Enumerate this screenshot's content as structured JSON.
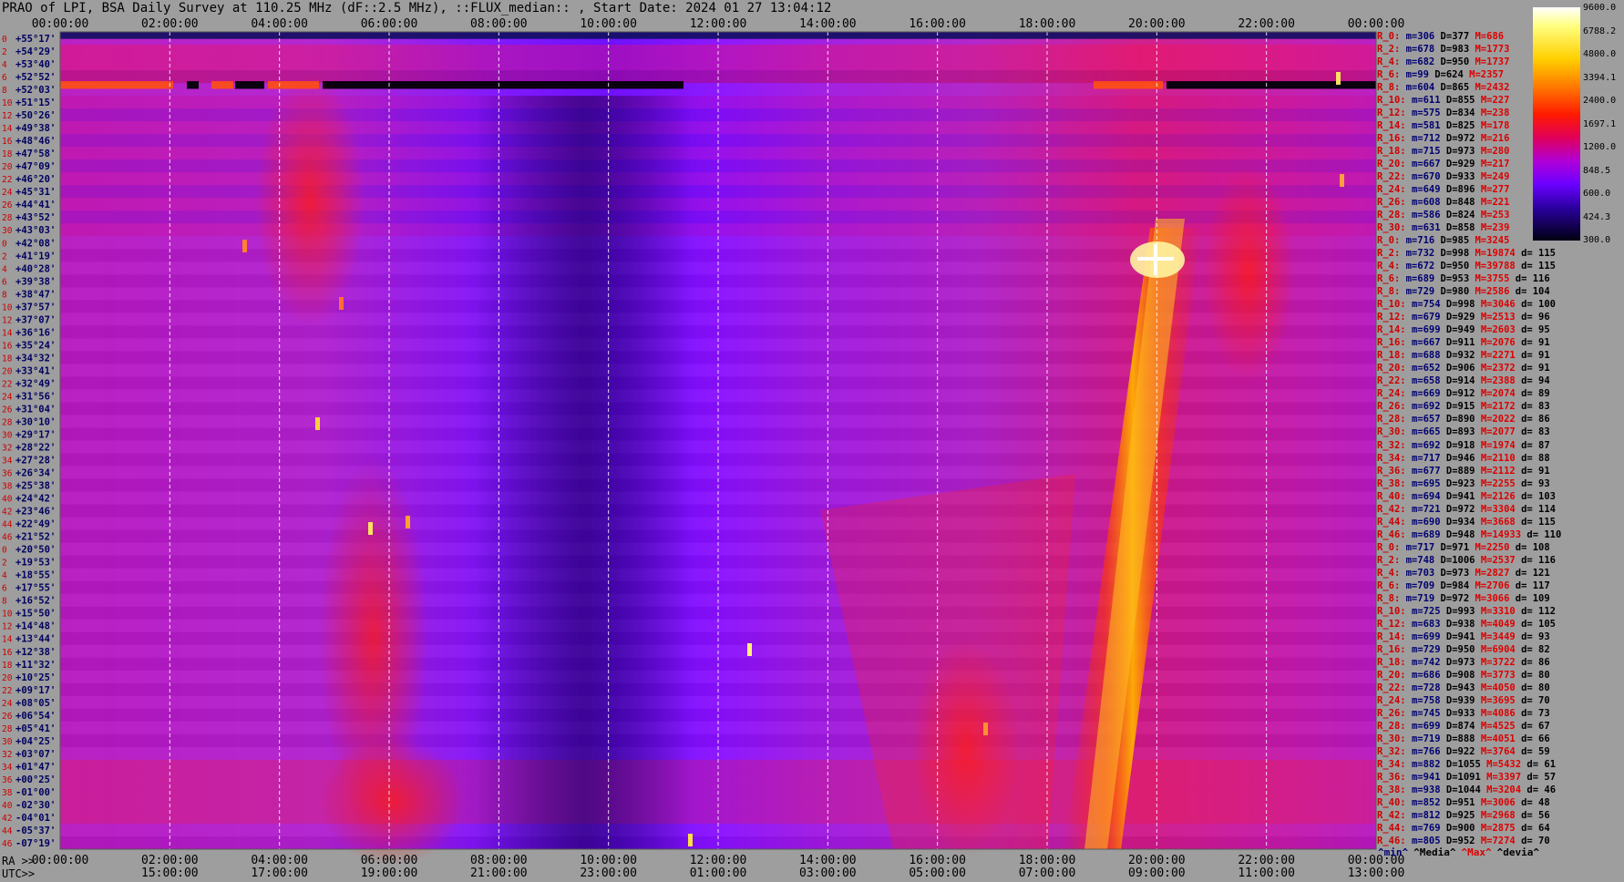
{
  "title": "PRAO of LPI, BSA Daily Survey at 110.25 MHz (dF::2.5 MHz), ::FLUX_median:: , Start Date: 2024 01 27 13:04:12",
  "ra_prefix": "RA >>",
  "utc_prefix": "UTC>>",
  "top_axis": [
    "00:00:00",
    "02:00:00",
    "04:00:00",
    "06:00:00",
    "08:00:00",
    "10:00:00",
    "12:00:00",
    "14:00:00",
    "16:00:00",
    "18:00:00",
    "20:00:00",
    "22:00:00",
    "00:00:00"
  ],
  "bottom_ra_axis": [
    "00:00:00",
    "02:00:00",
    "04:00:00",
    "06:00:00",
    "08:00:00",
    "10:00:00",
    "12:00:00",
    "14:00:00",
    "16:00:00",
    "18:00:00",
    "20:00:00",
    "22:00:00",
    "00:00:00"
  ],
  "bottom_utc_axis": [
    "15:00:00",
    "17:00:00",
    "19:00:00",
    "21:00:00",
    "23:00:00",
    "01:00:00",
    "03:00:00",
    "05:00:00",
    "07:00:00",
    "09:00:00",
    "11:00:00",
    "13:00:00"
  ],
  "row_indices": [
    "0",
    "2",
    "4",
    "6",
    "8",
    "10",
    "12",
    "14",
    "16",
    "18",
    "20",
    "22",
    "24",
    "26",
    "28",
    "30",
    "0",
    "2",
    "4",
    "6",
    "8",
    "10",
    "12",
    "14",
    "16",
    "18",
    "20",
    "22",
    "24",
    "26",
    "28",
    "30",
    "32",
    "34",
    "36",
    "38",
    "40",
    "42",
    "44",
    "46",
    "0",
    "2",
    "4",
    "6",
    "8",
    "10",
    "12",
    "14",
    "16",
    "18",
    "20",
    "22",
    "24",
    "26",
    "28",
    "30",
    "32",
    "34",
    "36",
    "38",
    "40",
    "42",
    "44",
    "46"
  ],
  "declinations": [
    "+55°17'",
    "+54°29'",
    "+53°40'",
    "+52°52'",
    "+52°03'",
    "+51°15'",
    "+50°26'",
    "+49°38'",
    "+48°46'",
    "+47°58'",
    "+47°09'",
    "+46°20'",
    "+45°31'",
    "+44°41'",
    "+43°52'",
    "+43°03'",
    "+42°08'",
    "+41°19'",
    "+40°28'",
    "+39°38'",
    "+38°47'",
    "+37°57'",
    "+37°07'",
    "+36°16'",
    "+35°24'",
    "+34°32'",
    "+33°41'",
    "+32°49'",
    "+31°56'",
    "+31°04'",
    "+30°10'",
    "+29°17'",
    "+28°22'",
    "+27°28'",
    "+26°34'",
    "+25°38'",
    "+24°42'",
    "+23°46'",
    "+22°49'",
    "+21°52'",
    "+20°50'",
    "+19°53'",
    "+18°55'",
    "+17°55'",
    "+16°52'",
    "+15°50'",
    "+14°48'",
    "+13°44'",
    "+12°38'",
    "+11°32'",
    "+10°25'",
    "+09°17'",
    "+08°05'",
    "+06°54'",
    "+05°41'",
    "+04°25'",
    "+03°07'",
    "+01°47'",
    "+00°25'",
    "-01°00'",
    "-02°30'",
    "-04°01'",
    "-05°37'",
    "-07°19'"
  ],
  "stats": [
    {
      "label": "R_0:",
      "min": "m=306",
      "median": "D=377",
      "max": "M=686",
      "devia": ""
    },
    {
      "label": "R_2:",
      "min": "m=678",
      "median": "D=983",
      "max": "M=1773",
      "devia": ""
    },
    {
      "label": "R_4:",
      "min": "m=682",
      "median": "D=950",
      "max": "M=1737",
      "devia": ""
    },
    {
      "label": "R_6:",
      "min": "m=99",
      "median": "D=624",
      "max": "M=2357",
      "devia": ""
    },
    {
      "label": "R_8:",
      "min": "m=604",
      "median": "D=865",
      "max": "M=2432",
      "devia": ""
    },
    {
      "label": "R_10:",
      "min": "m=611",
      "median": "D=855",
      "max": "M=227",
      "devia": ""
    },
    {
      "label": "R_12:",
      "min": "m=575",
      "median": "D=834",
      "max": "M=238",
      "devia": ""
    },
    {
      "label": "R_14:",
      "min": "m=581",
      "median": "D=825",
      "max": "M=178",
      "devia": ""
    },
    {
      "label": "R_16:",
      "min": "m=712",
      "median": "D=972",
      "max": "M=216",
      "devia": ""
    },
    {
      "label": "R_18:",
      "min": "m=715",
      "median": "D=973",
      "max": "M=280",
      "devia": ""
    },
    {
      "label": "R_20:",
      "min": "m=667",
      "median": "D=929",
      "max": "M=217",
      "devia": ""
    },
    {
      "label": "R_22:",
      "min": "m=670",
      "median": "D=933",
      "max": "M=249",
      "devia": ""
    },
    {
      "label": "R_24:",
      "min": "m=649",
      "median": "D=896",
      "max": "M=277",
      "devia": ""
    },
    {
      "label": "R_26:",
      "min": "m=608",
      "median": "D=848",
      "max": "M=221",
      "devia": ""
    },
    {
      "label": "R_28:",
      "min": "m=586",
      "median": "D=824",
      "max": "M=253",
      "devia": ""
    },
    {
      "label": "R_30:",
      "min": "m=631",
      "median": "D=858",
      "max": "M=239",
      "devia": ""
    },
    {
      "label": "R_0:",
      "min": "m=716",
      "median": "D=985",
      "max": "M=3245",
      "devia": ""
    },
    {
      "label": "R_2:",
      "min": "m=732",
      "median": "D=998",
      "max": "M=19874",
      "devia": "d= 115"
    },
    {
      "label": "R_4:",
      "min": "m=672",
      "median": "D=950",
      "max": "M=39788",
      "devia": "d= 115"
    },
    {
      "label": "R_6:",
      "min": "m=689",
      "median": "D=953",
      "max": "M=3755",
      "devia": "d= 116"
    },
    {
      "label": "R_8:",
      "min": "m=729",
      "median": "D=980",
      "max": "M=2586",
      "devia": "d= 104"
    },
    {
      "label": "R_10:",
      "min": "m=754",
      "median": "D=998",
      "max": "M=3046",
      "devia": "d= 100"
    },
    {
      "label": "R_12:",
      "min": "m=679",
      "median": "D=929",
      "max": "M=2513",
      "devia": "d= 96"
    },
    {
      "label": "R_14:",
      "min": "m=699",
      "median": "D=949",
      "max": "M=2603",
      "devia": "d= 95"
    },
    {
      "label": "R_16:",
      "min": "m=667",
      "median": "D=911",
      "max": "M=2076",
      "devia": "d= 91"
    },
    {
      "label": "R_18:",
      "min": "m=688",
      "median": "D=932",
      "max": "M=2271",
      "devia": "d= 91"
    },
    {
      "label": "R_20:",
      "min": "m=652",
      "median": "D=906",
      "max": "M=2372",
      "devia": "d= 91"
    },
    {
      "label": "R_22:",
      "min": "m=658",
      "median": "D=914",
      "max": "M=2388",
      "devia": "d= 94"
    },
    {
      "label": "R_24:",
      "min": "m=669",
      "median": "D=912",
      "max": "M=2074",
      "devia": "d= 89"
    },
    {
      "label": "R_26:",
      "min": "m=692",
      "median": "D=915",
      "max": "M=2172",
      "devia": "d= 83"
    },
    {
      "label": "R_28:",
      "min": "m=657",
      "median": "D=890",
      "max": "M=2022",
      "devia": "d= 86"
    },
    {
      "label": "R_30:",
      "min": "m=665",
      "median": "D=893",
      "max": "M=2077",
      "devia": "d= 83"
    },
    {
      "label": "R_32:",
      "min": "m=692",
      "median": "D=918",
      "max": "M=1974",
      "devia": "d= 87"
    },
    {
      "label": "R_34:",
      "min": "m=717",
      "median": "D=946",
      "max": "M=2110",
      "devia": "d= 88"
    },
    {
      "label": "R_36:",
      "min": "m=677",
      "median": "D=889",
      "max": "M=2112",
      "devia": "d= 91"
    },
    {
      "label": "R_38:",
      "min": "m=695",
      "median": "D=923",
      "max": "M=2255",
      "devia": "d= 93"
    },
    {
      "label": "R_40:",
      "min": "m=694",
      "median": "D=941",
      "max": "M=2126",
      "devia": "d= 103"
    },
    {
      "label": "R_42:",
      "min": "m=721",
      "median": "D=972",
      "max": "M=3304",
      "devia": "d= 114"
    },
    {
      "label": "R_44:",
      "min": "m=690",
      "median": "D=934",
      "max": "M=3668",
      "devia": "d= 115"
    },
    {
      "label": "R_46:",
      "min": "m=689",
      "median": "D=948",
      "max": "M=14933",
      "devia": "d= 110"
    },
    {
      "label": "R_0:",
      "min": "m=717",
      "median": "D=971",
      "max": "M=2250",
      "devia": "d= 108"
    },
    {
      "label": "R_2:",
      "min": "m=748",
      "median": "D=1006",
      "max": "M=2537",
      "devia": "d= 116"
    },
    {
      "label": "R_4:",
      "min": "m=703",
      "median": "D=973",
      "max": "M=2827",
      "devia": "d= 121"
    },
    {
      "label": "R_6:",
      "min": "m=709",
      "median": "D=984",
      "max": "M=2706",
      "devia": "d= 117"
    },
    {
      "label": "R_8:",
      "min": "m=719",
      "median": "D=972",
      "max": "M=3066",
      "devia": "d= 109"
    },
    {
      "label": "R_10:",
      "min": "m=725",
      "median": "D=993",
      "max": "M=3310",
      "devia": "d= 112"
    },
    {
      "label": "R_12:",
      "min": "m=683",
      "median": "D=938",
      "max": "M=4049",
      "devia": "d= 105"
    },
    {
      "label": "R_14:",
      "min": "m=699",
      "median": "D=941",
      "max": "M=3449",
      "devia": "d= 93"
    },
    {
      "label": "R_16:",
      "min": "m=729",
      "median": "D=950",
      "max": "M=6904",
      "devia": "d= 82"
    },
    {
      "label": "R_18:",
      "min": "m=742",
      "median": "D=973",
      "max": "M=3722",
      "devia": "d= 86"
    },
    {
      "label": "R_20:",
      "min": "m=686",
      "median": "D=908",
      "max": "M=3773",
      "devia": "d= 80"
    },
    {
      "label": "R_22:",
      "min": "m=728",
      "median": "D=943",
      "max": "M=4050",
      "devia": "d= 80"
    },
    {
      "label": "R_24:",
      "min": "m=758",
      "median": "D=939",
      "max": "M=3695",
      "devia": "d= 70"
    },
    {
      "label": "R_26:",
      "min": "m=745",
      "median": "D=933",
      "max": "M=4086",
      "devia": "d= 73"
    },
    {
      "label": "R_28:",
      "min": "m=699",
      "median": "D=874",
      "max": "M=4525",
      "devia": "d= 67"
    },
    {
      "label": "R_30:",
      "min": "m=719",
      "median": "D=888",
      "max": "M=4051",
      "devia": "d= 66"
    },
    {
      "label": "R_32:",
      "min": "m=766",
      "median": "D=922",
      "max": "M=3764",
      "devia": "d= 59"
    },
    {
      "label": "R_34:",
      "min": "m=882",
      "median": "D=1055",
      "max": "M=5432",
      "devia": "d= 61"
    },
    {
      "label": "R_36:",
      "min": "m=941",
      "median": "D=1091",
      "max": "M=3397",
      "devia": "d= 57"
    },
    {
      "label": "R_38:",
      "min": "m=938",
      "median": "D=1044",
      "max": "M=3204",
      "devia": "d= 46"
    },
    {
      "label": "R_40:",
      "min": "m=852",
      "median": "D=951",
      "max": "M=3006",
      "devia": "d= 48"
    },
    {
      "label": "R_42:",
      "min": "m=812",
      "median": "D=925",
      "max": "M=2968",
      "devia": "d= 56"
    },
    {
      "label": "R_44:",
      "min": "m=769",
      "median": "D=900",
      "max": "M=2875",
      "devia": "d= 64"
    },
    {
      "label": "R_46:",
      "min": "m=805",
      "median": "D=952",
      "max": "M=7274",
      "devia": "d= 70"
    }
  ],
  "legend_keys": [
    {
      "text": "^min^",
      "color": "#000070"
    },
    {
      "text": "^Media^",
      "color": "#000000"
    },
    {
      "text": "^Max^",
      "color": "#dd0000"
    },
    {
      "text": "^devia^",
      "color": "#000000"
    }
  ],
  "color_scale": [
    "9600.0",
    "6788.2",
    "4800.0",
    "3394.1",
    "2400.0",
    "1697.1",
    "1200.0",
    "848.5",
    "600.0",
    "424.3",
    "300.0"
  ],
  "chart_data": {
    "type": "heatmap",
    "title": "PRAO of LPI, BSA Daily Survey at 110.25 MHz (dF::2.5 MHz), ::FLUX_median:: , Start Date: 2024 01 27 13:04:12",
    "x_axis_top": "RA 00:00:00 - 24:00:00",
    "x_axis_bottom": [
      "RA",
      "UTC"
    ],
    "y_axis": "Declination (+55°17' to -07°19')",
    "color_scale_min": 300,
    "color_scale_max": 9600,
    "color_scale": "log",
    "rows": 64,
    "grid": "dashed vertical lines every 2h"
  }
}
